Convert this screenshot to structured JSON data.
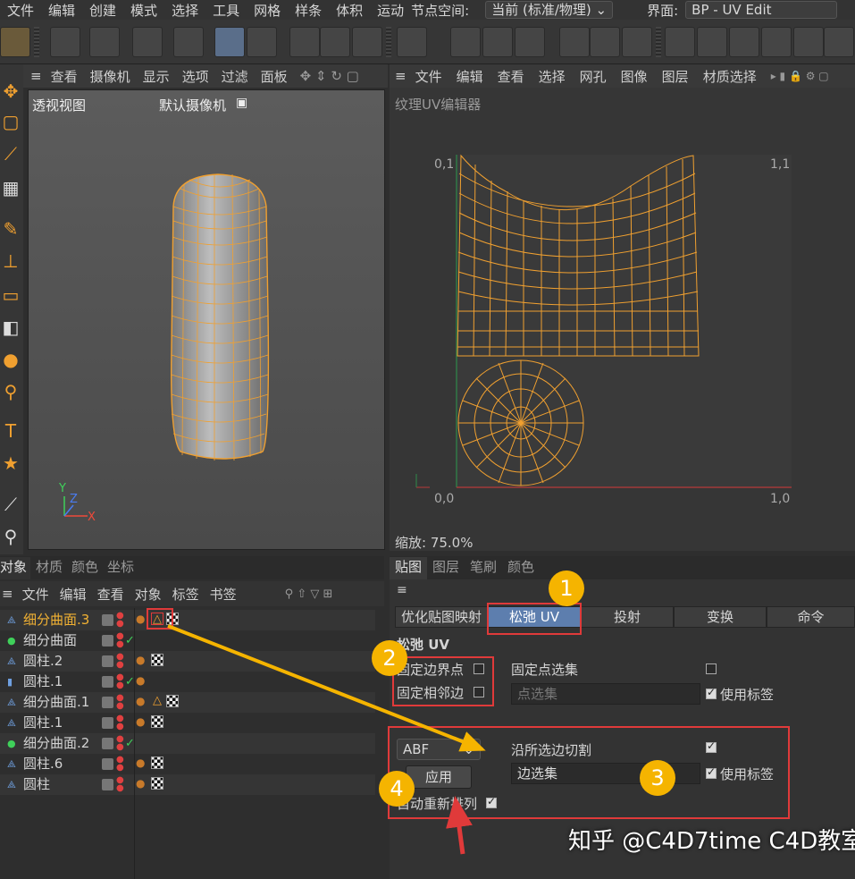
{
  "menubar": {
    "items": [
      "文件",
      "编辑",
      "创建",
      "模式",
      "选择",
      "工具",
      "网格",
      "样条",
      "体积",
      "运动"
    ],
    "node_space_label": "节点空间:",
    "node_space_value": "当前 (标准/物理)",
    "layout_label": "界面:",
    "layout_value": "BP - UV Edit"
  },
  "viewport": {
    "menu": [
      "查看",
      "摄像机",
      "显示",
      "选项",
      "过滤",
      "面板"
    ],
    "view_name": "透视视图",
    "camera_name": "默认摄像机",
    "axis_x": "X",
    "axis_y": "Y",
    "axis_z": "Z"
  },
  "uv_editor": {
    "menu": [
      "文件",
      "编辑",
      "查看",
      "选择",
      "网孔",
      "图像",
      "图层",
      "材质选择"
    ],
    "title": "纹理UV编辑器",
    "corner_tl": "0,1",
    "corner_tr": "1,1",
    "corner_bl": "0,0",
    "corner_br": "1,0",
    "zoom_label": "缩放: 75.0%"
  },
  "objects": {
    "tabs": [
      "对象",
      "材质",
      "颜色",
      "坐标"
    ],
    "menu": [
      "文件",
      "编辑",
      "查看",
      "对象",
      "标签",
      "书签"
    ],
    "rows": [
      {
        "name": "细分曲面.3",
        "selected": true
      },
      {
        "name": "细分曲面",
        "selected": false
      },
      {
        "name": "圆柱.2",
        "selected": false
      },
      {
        "name": "圆柱.1",
        "selected": false
      },
      {
        "name": "细分曲面.1",
        "selected": false
      },
      {
        "name": "圆柱.1",
        "selected": false
      },
      {
        "name": "细分曲面.2",
        "selected": false
      },
      {
        "name": "圆柱.6",
        "selected": false
      },
      {
        "name": "圆柱",
        "selected": false
      }
    ]
  },
  "attributes": {
    "tabs": [
      "贴图",
      "图层",
      "笔刷",
      "颜色"
    ],
    "subtabs": [
      "优化贴图映射",
      "松弛 UV",
      "投射",
      "变换",
      "命令"
    ],
    "section_title": "松弛 UV",
    "pin_border": "固定边界点",
    "pin_neighbors": "固定相邻边",
    "pin_point_sel": "固定点选集",
    "point_sel_placeholder": "点选集",
    "use_tags_1": "使用标签",
    "method": "ABF",
    "cut_along_edges": "沿所选边切割",
    "edge_sel_value": "边选集",
    "use_tags_2": "使用标签",
    "apply": "应用",
    "auto_realign": "自动重新排列"
  },
  "badges": [
    "1",
    "2",
    "3",
    "4"
  ],
  "watermark": "知乎 @C4D7time C4D教室",
  "colors": {
    "accent": "#f0a030",
    "highlight": "#5d7eae",
    "annotation_red": "#e03a3a",
    "annotation_yellow": "#f5b400"
  }
}
